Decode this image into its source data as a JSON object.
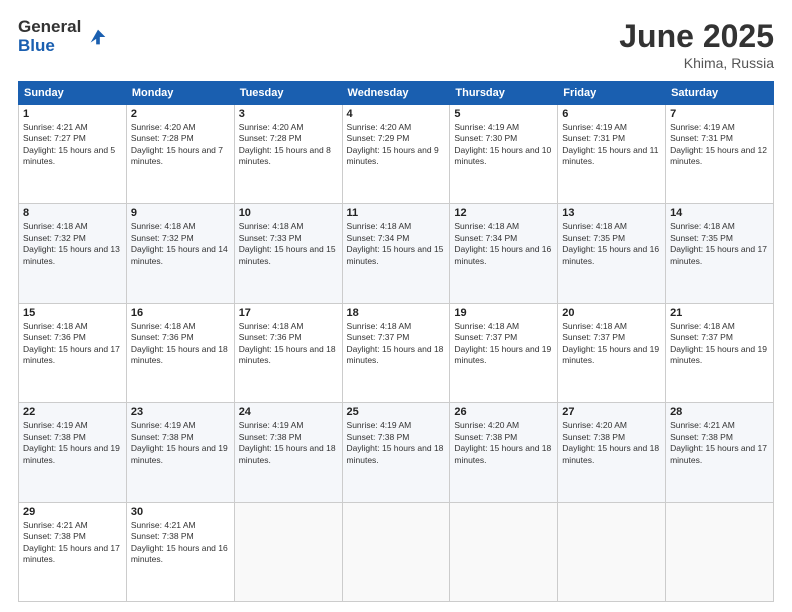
{
  "logo": {
    "general": "General",
    "blue": "Blue"
  },
  "title": {
    "month": "June 2025",
    "location": "Khima, Russia"
  },
  "weekdays": [
    "Sunday",
    "Monday",
    "Tuesday",
    "Wednesday",
    "Thursday",
    "Friday",
    "Saturday"
  ],
  "weeks": [
    [
      {
        "day": "1",
        "sunrise": "4:21 AM",
        "sunset": "7:27 PM",
        "daylight": "15 hours and 5 minutes."
      },
      {
        "day": "2",
        "sunrise": "4:20 AM",
        "sunset": "7:28 PM",
        "daylight": "15 hours and 7 minutes."
      },
      {
        "day": "3",
        "sunrise": "4:20 AM",
        "sunset": "7:28 PM",
        "daylight": "15 hours and 8 minutes."
      },
      {
        "day": "4",
        "sunrise": "4:20 AM",
        "sunset": "7:29 PM",
        "daylight": "15 hours and 9 minutes."
      },
      {
        "day": "5",
        "sunrise": "4:19 AM",
        "sunset": "7:30 PM",
        "daylight": "15 hours and 10 minutes."
      },
      {
        "day": "6",
        "sunrise": "4:19 AM",
        "sunset": "7:31 PM",
        "daylight": "15 hours and 11 minutes."
      },
      {
        "day": "7",
        "sunrise": "4:19 AM",
        "sunset": "7:31 PM",
        "daylight": "15 hours and 12 minutes."
      }
    ],
    [
      {
        "day": "8",
        "sunrise": "4:18 AM",
        "sunset": "7:32 PM",
        "daylight": "15 hours and 13 minutes."
      },
      {
        "day": "9",
        "sunrise": "4:18 AM",
        "sunset": "7:32 PM",
        "daylight": "15 hours and 14 minutes."
      },
      {
        "day": "10",
        "sunrise": "4:18 AM",
        "sunset": "7:33 PM",
        "daylight": "15 hours and 15 minutes."
      },
      {
        "day": "11",
        "sunrise": "4:18 AM",
        "sunset": "7:34 PM",
        "daylight": "15 hours and 15 minutes."
      },
      {
        "day": "12",
        "sunrise": "4:18 AM",
        "sunset": "7:34 PM",
        "daylight": "15 hours and 16 minutes."
      },
      {
        "day": "13",
        "sunrise": "4:18 AM",
        "sunset": "7:35 PM",
        "daylight": "15 hours and 16 minutes."
      },
      {
        "day": "14",
        "sunrise": "4:18 AM",
        "sunset": "7:35 PM",
        "daylight": "15 hours and 17 minutes."
      }
    ],
    [
      {
        "day": "15",
        "sunrise": "4:18 AM",
        "sunset": "7:36 PM",
        "daylight": "15 hours and 17 minutes."
      },
      {
        "day": "16",
        "sunrise": "4:18 AM",
        "sunset": "7:36 PM",
        "daylight": "15 hours and 18 minutes."
      },
      {
        "day": "17",
        "sunrise": "4:18 AM",
        "sunset": "7:36 PM",
        "daylight": "15 hours and 18 minutes."
      },
      {
        "day": "18",
        "sunrise": "4:18 AM",
        "sunset": "7:37 PM",
        "daylight": "15 hours and 18 minutes."
      },
      {
        "day": "19",
        "sunrise": "4:18 AM",
        "sunset": "7:37 PM",
        "daylight": "15 hours and 19 minutes."
      },
      {
        "day": "20",
        "sunrise": "4:18 AM",
        "sunset": "7:37 PM",
        "daylight": "15 hours and 19 minutes."
      },
      {
        "day": "21",
        "sunrise": "4:18 AM",
        "sunset": "7:37 PM",
        "daylight": "15 hours and 19 minutes."
      }
    ],
    [
      {
        "day": "22",
        "sunrise": "4:19 AM",
        "sunset": "7:38 PM",
        "daylight": "15 hours and 19 minutes."
      },
      {
        "day": "23",
        "sunrise": "4:19 AM",
        "sunset": "7:38 PM",
        "daylight": "15 hours and 19 minutes."
      },
      {
        "day": "24",
        "sunrise": "4:19 AM",
        "sunset": "7:38 PM",
        "daylight": "15 hours and 18 minutes."
      },
      {
        "day": "25",
        "sunrise": "4:19 AM",
        "sunset": "7:38 PM",
        "daylight": "15 hours and 18 minutes."
      },
      {
        "day": "26",
        "sunrise": "4:20 AM",
        "sunset": "7:38 PM",
        "daylight": "15 hours and 18 minutes."
      },
      {
        "day": "27",
        "sunrise": "4:20 AM",
        "sunset": "7:38 PM",
        "daylight": "15 hours and 18 minutes."
      },
      {
        "day": "28",
        "sunrise": "4:21 AM",
        "sunset": "7:38 PM",
        "daylight": "15 hours and 17 minutes."
      }
    ],
    [
      {
        "day": "29",
        "sunrise": "4:21 AM",
        "sunset": "7:38 PM",
        "daylight": "15 hours and 17 minutes."
      },
      {
        "day": "30",
        "sunrise": "4:21 AM",
        "sunset": "7:38 PM",
        "daylight": "15 hours and 16 minutes."
      },
      null,
      null,
      null,
      null,
      null
    ]
  ]
}
